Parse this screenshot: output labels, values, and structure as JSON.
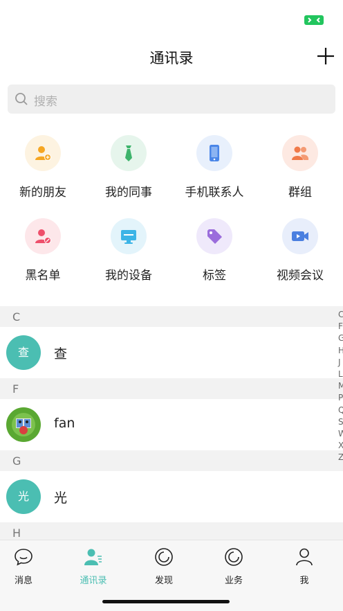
{
  "header": {
    "title": "通讯录"
  },
  "search": {
    "placeholder": "搜索"
  },
  "quick_entries": [
    {
      "label": "新的朋友",
      "icon": "add-friend-icon"
    },
    {
      "label": "我的同事",
      "icon": "colleague-tie-icon"
    },
    {
      "label": "手机联系人",
      "icon": "phone-contact-icon"
    },
    {
      "label": "群组",
      "icon": "group-icon"
    },
    {
      "label": "黑名单",
      "icon": "blocked-user-icon"
    },
    {
      "label": "我的设备",
      "icon": "monitor-icon"
    },
    {
      "label": "标签",
      "icon": "tag-icon"
    },
    {
      "label": "视频会议",
      "icon": "video-camera-icon"
    }
  ],
  "contacts": {
    "sections": [
      {
        "letter": "C",
        "items": [
          {
            "name": "查",
            "avatar_text": "查"
          }
        ]
      },
      {
        "letter": "F",
        "items": [
          {
            "name": "fan"
          }
        ]
      },
      {
        "letter": "G",
        "items": [
          {
            "name": "光",
            "avatar_text": "光"
          }
        ]
      },
      {
        "letter": "H",
        "items": []
      }
    ]
  },
  "index_letters": [
    "C",
    "F",
    "G",
    "H",
    "J",
    "L",
    "M",
    "P",
    "Q",
    "S",
    "W",
    "X",
    "Z"
  ],
  "tabbar": {
    "tabs": [
      {
        "label": "消息",
        "icon": "chat-bubble-icon"
      },
      {
        "label": "通讯录",
        "icon": "contacts-icon",
        "active": true
      },
      {
        "label": "发现",
        "icon": "discover-icon"
      },
      {
        "label": "业务",
        "icon": "business-icon"
      },
      {
        "label": "我",
        "icon": "profile-icon"
      }
    ]
  },
  "colors": {
    "accent": "#4bbeb2",
    "status_green": "#22c55e"
  }
}
